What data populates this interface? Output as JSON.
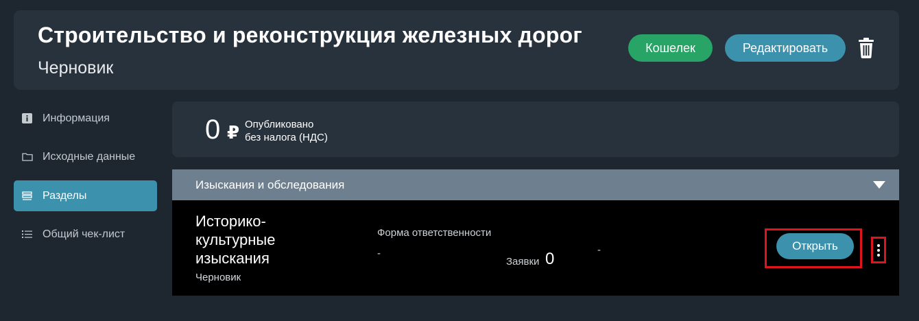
{
  "header": {
    "title": "Строительство и реконструкция железных дорог",
    "subtitle": "Черновик",
    "wallet_label": "Кошелек",
    "edit_label": "Редактировать",
    "delete_icon": "trash-icon"
  },
  "sidebar": {
    "items": [
      {
        "label": "Информация",
        "icon": "info-icon",
        "active": false
      },
      {
        "label": "Исходные данные",
        "icon": "folder-icon",
        "active": false
      },
      {
        "label": "Разделы",
        "icon": "sections-icon",
        "active": true
      },
      {
        "label": "Общий чек-лист",
        "icon": "checklist-icon",
        "active": false
      }
    ]
  },
  "price": {
    "value": "0",
    "currency": "₽",
    "caption_line1": "Опубликовано",
    "caption_line2": "без налога (НДС)"
  },
  "section": {
    "title": "Изыскания и обследования",
    "toggle_icon": "chevron-down-icon"
  },
  "row": {
    "name": "Историко-культурные изыскания",
    "status": "Черновик",
    "responsibility_label": "Форма ответственности",
    "responsibility_value": "-",
    "bids_label": "Заявки",
    "bids_value": "0",
    "extra_value": "-",
    "open_label": "Открыть",
    "more_icon": "more-vertical-icon"
  },
  "colors": {
    "background": "#1e2730",
    "card": "#28323c",
    "accent": "#3c92ac",
    "wallet": "#27a466",
    "section_bar": "#6e808f",
    "highlight": "#e0141e"
  }
}
